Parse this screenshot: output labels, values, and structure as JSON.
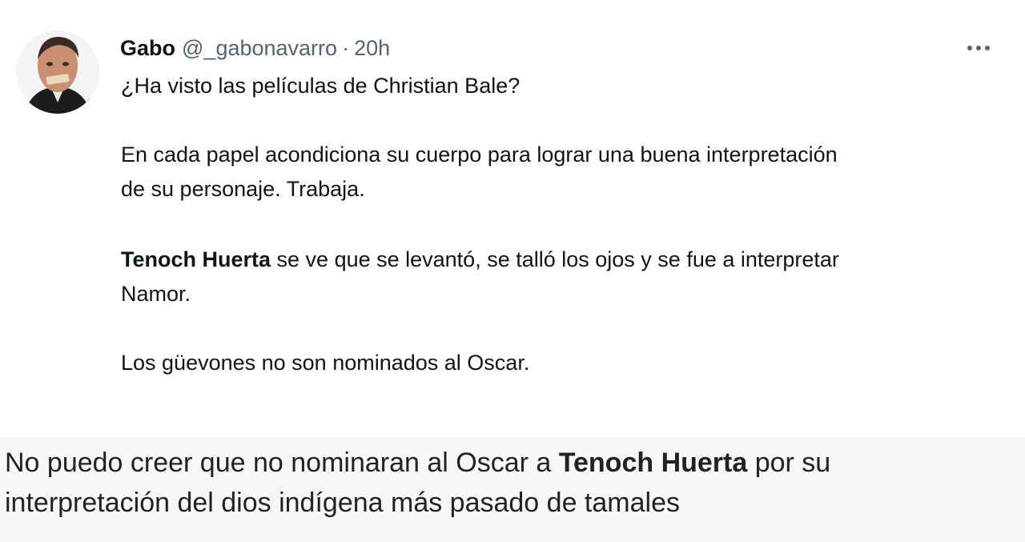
{
  "tweet": {
    "author_name": "Gabo",
    "handle": "@_gabonavarro",
    "separator": "·",
    "time": "20h",
    "more_icon": "more-horizontal-icon",
    "p1": "¿Ha visto las películas de Christian Bale?",
    "p2_line1": "En cada papel acondiciona su cuerpo para lograr una buena interpretación",
    "p2_line2": "de su personaje.  Trabaja.",
    "p3_bold": "Tenoch Huerta",
    "p3_rest_line1": " se ve que se levantó,  se talló los ojos y se fue a interpretar",
    "p3_line2": "Namor.",
    "p4": "Los güevones no son nominados al  Oscar."
  },
  "caption": {
    "part1": "No puedo creer que no nominaran al Oscar a ",
    "bold": "Tenoch Huerta",
    "part2": " por su",
    "line2": "interpretación del dios indígena más pasado de tamales"
  },
  "colors": {
    "text": "#0f1419",
    "secondary": "#536471",
    "caption_bg": "#f7f7f7",
    "caption_text": "#222222"
  }
}
